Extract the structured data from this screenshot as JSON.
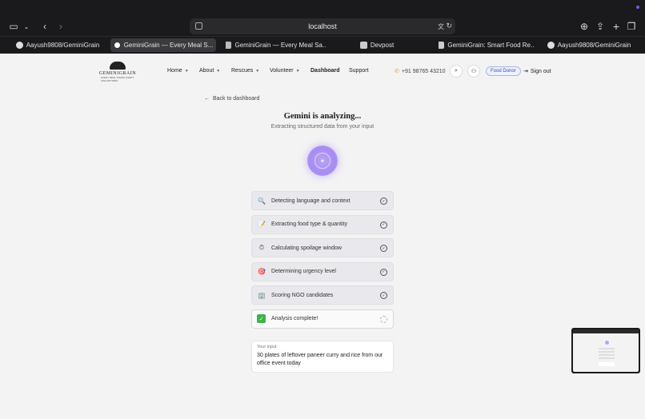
{
  "browser": {
    "url": "localhost",
    "tabs": [
      {
        "label": "Aayush9808/GeminiGrain",
        "active": false
      },
      {
        "label": "GeminiGrain — Every Meal S...",
        "active": true
      },
      {
        "label": "GeminiGrain — Every Meal Sa...",
        "active": false
      },
      {
        "label": "Devpost",
        "active": false
      },
      {
        "label": "GeminiGrain: Smart Food Re...",
        "active": false
      },
      {
        "label": "Aayush9808/GeminiGrain",
        "active": false
      }
    ]
  },
  "site": {
    "logo_word": "GEMINIGRAIN",
    "logo_tag": "EVERY MEAL SAVED, EVERY LIFE MATTERS",
    "nav": [
      {
        "label": "Home",
        "dropdown": true
      },
      {
        "label": "About",
        "dropdown": true
      },
      {
        "label": "Rescues",
        "dropdown": true
      },
      {
        "label": "Volunteer",
        "dropdown": true
      },
      {
        "label": "Dashboard",
        "dropdown": false
      },
      {
        "label": "Support",
        "dropdown": false
      }
    ],
    "phone": "+91 98765 43210",
    "role_badge": "Food Donor",
    "sign_out": "Sign out"
  },
  "main": {
    "back_link": "Back to dashboard",
    "title": "Gemini is analyzing...",
    "subtitle": "Extracting structured data from your input",
    "steps": [
      {
        "icon": "🔍",
        "icon_name": "magnifier-icon",
        "label": "Detecting language and context"
      },
      {
        "icon": "📝",
        "icon_name": "memo-icon",
        "label": "Extracting food type & quantity"
      },
      {
        "icon": "⏱",
        "icon_name": "stopwatch-icon",
        "label": "Calculating spoilage window"
      },
      {
        "icon": "🎯",
        "icon_name": "target-icon",
        "label": "Determining urgency level"
      },
      {
        "icon": "🏢",
        "icon_name": "building-icon",
        "label": "Scoring NGO candidates"
      }
    ],
    "final_step": {
      "icon": "✓",
      "label": "Analysis complete!"
    },
    "input_card": {
      "label": "Your input",
      "value": "30 plates of leftover paneer curry and rice from our office event today"
    }
  },
  "colors": {
    "accent_purple": "#a78bf2",
    "badge_blue": "#3b4fa6",
    "success_green": "#3cb44b"
  }
}
